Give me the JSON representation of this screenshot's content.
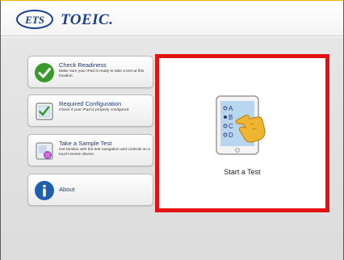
{
  "header": {
    "logo_mark": "ETS",
    "logo_text": "TOEIC."
  },
  "menu": [
    {
      "title": "Check Readiness",
      "description": "Make sure your iPad is ready to take a test at this location.",
      "icon": "check-circle-icon",
      "color": "#3a9a2c"
    },
    {
      "title": "Required Configuration",
      "description": "Check if your iPad is properly configured.",
      "icon": "settings-checklist-icon",
      "color": "#3a9a2c"
    },
    {
      "title": "Take a Sample Test",
      "description": "Get familiar with the test navigation and controls on a touch-screen device.",
      "icon": "sample-test-icon",
      "color": "#9c4dcc"
    },
    {
      "title": "About",
      "description": "",
      "icon": "info-icon",
      "color": "#1f5fb0"
    }
  ],
  "start": {
    "label": "Start a Test",
    "options": [
      "A",
      "B",
      "C",
      "D"
    ],
    "highlight_color": "#e01212"
  }
}
